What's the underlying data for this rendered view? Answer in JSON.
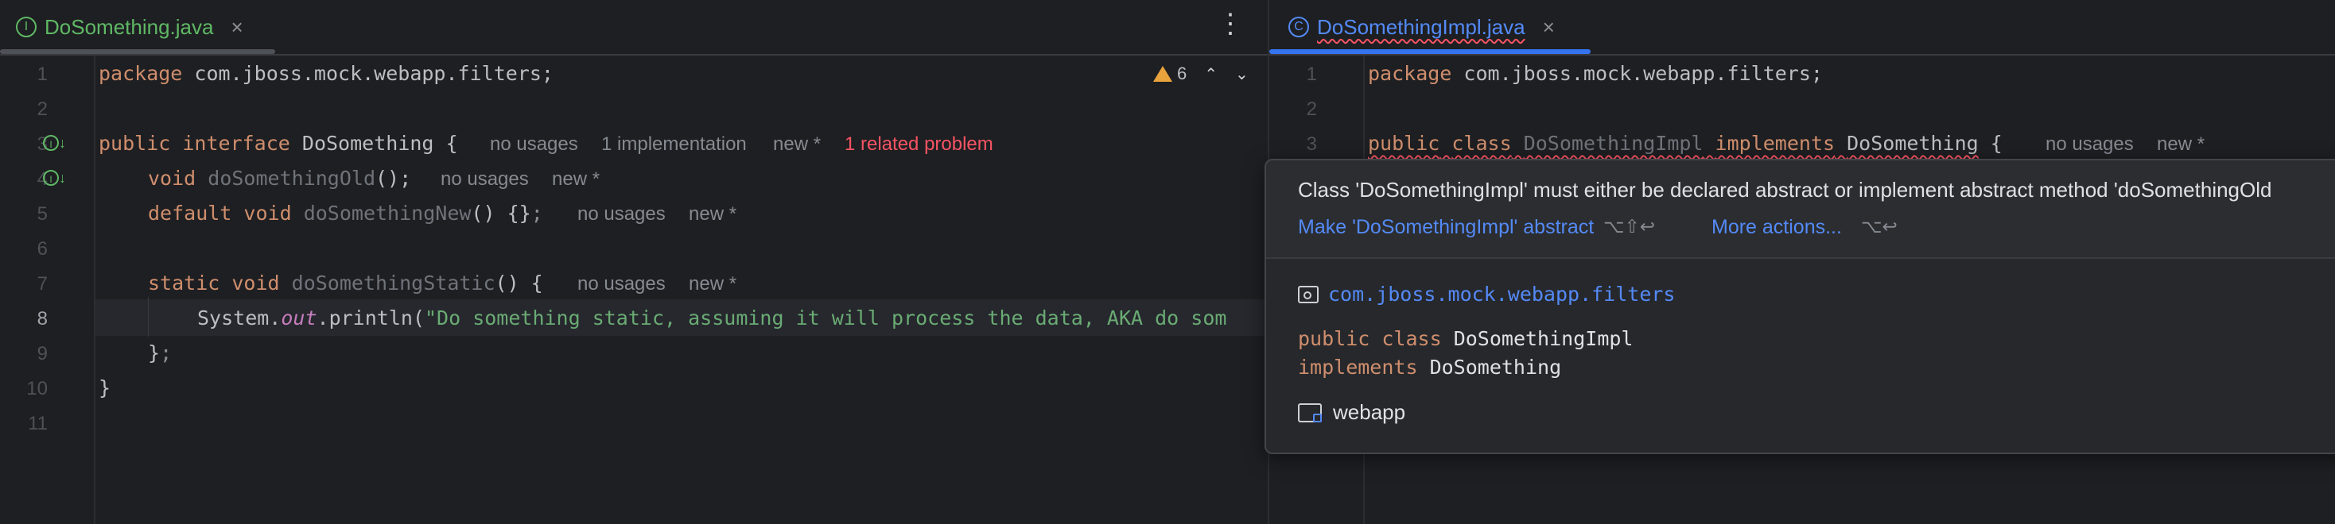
{
  "left_editor": {
    "tab": {
      "icon": "interface-icon",
      "icon_glyph": "I",
      "name": "DoSomething.java",
      "color": "#5fb865"
    },
    "more_icon": "⋮",
    "inspection": {
      "warning_count": "6"
    },
    "line_numbers": [
      "1",
      "2",
      "3",
      "4",
      "5",
      "6",
      "7",
      "8",
      "9",
      "10",
      "11"
    ],
    "current_line": "8",
    "code": {
      "l1_kw": "package",
      "l1_rest": " com.jboss.mock.webapp.filters;",
      "l3_kw1": "public",
      "l3_kw2": "interface",
      "l3_name": "DoSomething",
      "l3_brace": " {",
      "l4_kw": "void",
      "l4_name": "doSomethingOld",
      "l4_rest": "();",
      "l5_kw1": "default",
      "l5_kw2": "void",
      "l5_name": "doSomethingNew",
      "l5_rest": "() {}",
      "l5_semi": ";",
      "l7_kw1": "static",
      "l7_kw2": "void",
      "l7_name": "doSomethingStatic",
      "l7_rest": "() {",
      "l8_a": "System.",
      "l8_field": "out",
      "l8_b": ".println(",
      "l8_str": "\"Do something static, assuming it will process the data, AKA do som",
      "l9_a": "}",
      "l9_b": ";",
      "l10": "}"
    },
    "inlays": {
      "l3_usages": "no usages",
      "l3_impl": "1 implementation",
      "l3_new": "new *",
      "l3_problem": "1 related problem",
      "l4_usages": "no usages",
      "l4_new": "new *",
      "l5_usages": "no usages",
      "l5_new": "new *",
      "l7_usages": "no usages",
      "l7_new": "new *"
    }
  },
  "right_editor": {
    "tab": {
      "icon": "class-icon",
      "icon_glyph": "C",
      "name": "DoSomethingImpl.java",
      "color": "#548af7"
    },
    "line_numbers": [
      "1",
      "2",
      "3"
    ],
    "code": {
      "l1_kw": "package",
      "l1_rest": " com.jboss.mock.webapp.filters;",
      "l3_kw1": "public",
      "l3_kw2": "class",
      "l3_name": "DoSomethingImpl",
      "l3_kw3": "implements",
      "l3_iface": "DoSomething",
      "l3_brace": " {"
    },
    "inlays": {
      "l3_usages": "no usages",
      "l3_new": "new *"
    }
  },
  "popup": {
    "message": "Class 'DoSomethingImpl' must either be declared abstract or implement abstract method 'doSomethingOld",
    "fix_label": "Make 'DoSomethingImpl' abstract",
    "fix_shortcut": "⌥⇧↩",
    "more_label": "More actions...",
    "more_shortcut": "⌥↩",
    "package": "com.jboss.mock.webapp.filters",
    "decl_kw1": "public",
    "decl_kw2": "class",
    "decl_name": "DoSomethingImpl",
    "decl_kw3": "implements",
    "decl_iface": "DoSomething",
    "folder": "webapp"
  }
}
